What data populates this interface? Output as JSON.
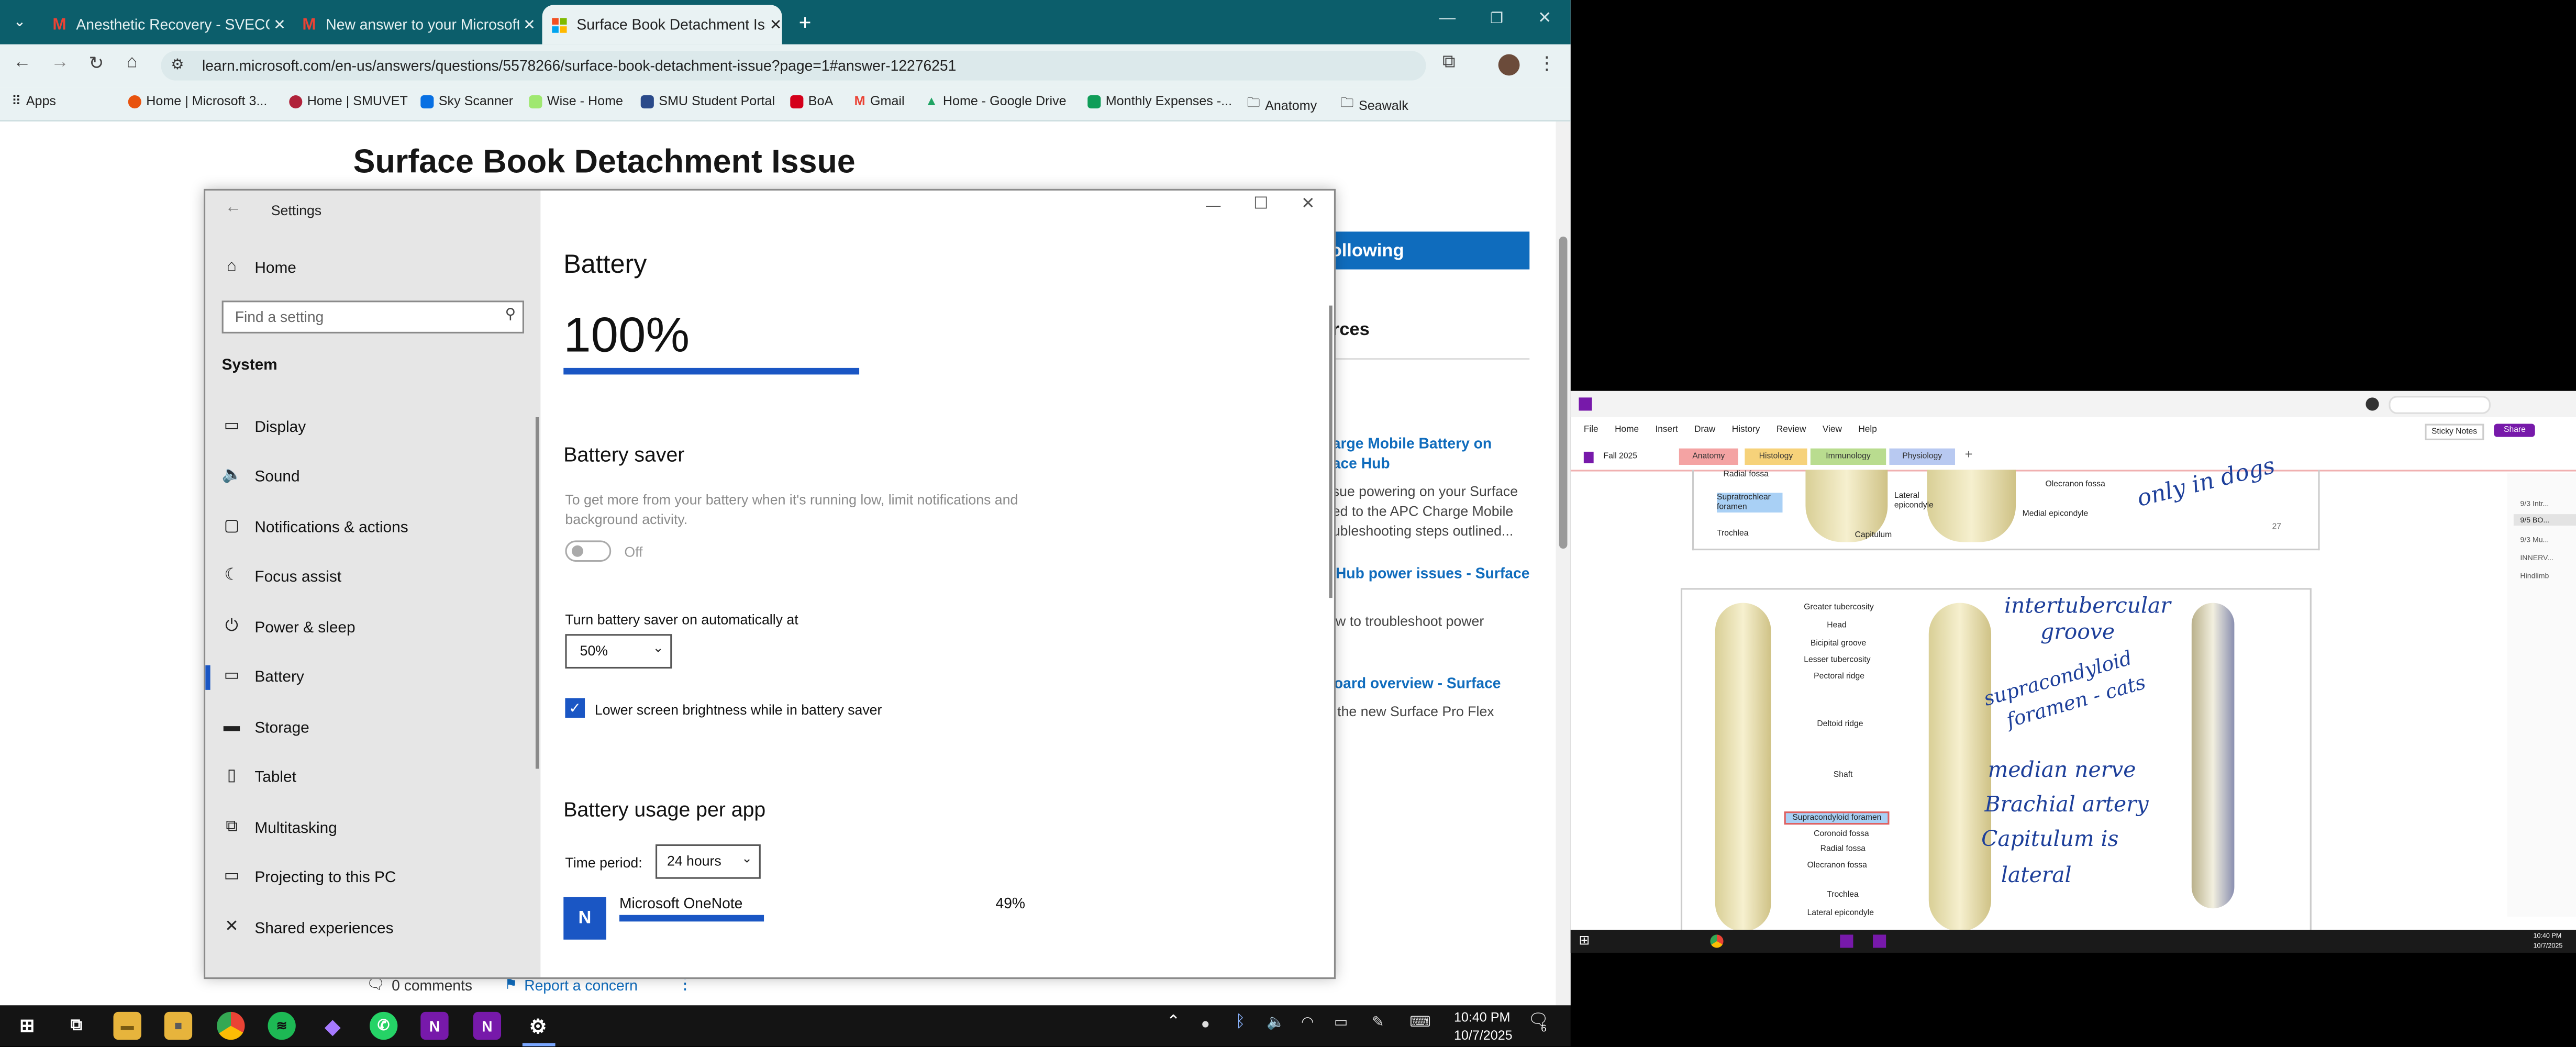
{
  "browser": {
    "tabs": [
      {
        "title": "Anesthetic Recovery - SVECCs",
        "favicon": "gmail"
      },
      {
        "title": "New answer to your Microsoft",
        "favicon": "gmail"
      },
      {
        "title": "Surface Book Detachment Issue",
        "favicon": "microsoft"
      }
    ],
    "url": "learn.microsoft.com/en-us/answers/questions/5578266/surface-book-detachment-issue?page=1#answer-12276251",
    "bookmarks": [
      "Apps",
      "Home | Microsoft 3...",
      "Home | SMUVET",
      "Sky Scanner",
      "Wise - Home",
      "SMU Student Portal",
      "BoA",
      "Gmail",
      "Home - Google Drive",
      "Monthly Expenses -...",
      "Anatomy",
      "Seawalk"
    ]
  },
  "qa_page": {
    "title": "Surface Book Detachment Issue",
    "follow_button": "ollowing",
    "resources_heading": "rces",
    "related": [
      {
        "link": "arge Mobile Battery on",
        "link2": "ace Hub",
        "desc": "sue powering on your Surface",
        "desc2": "ed to the APC Charge Mobile",
        "desc3": "ubleshooting steps outlined..."
      },
      {
        "link": "Hub power issues - Surface",
        "desc": "w to troubleshoot power"
      },
      {
        "link": "oard overview - Surface",
        "desc": "the new Surface Pro Flex"
      }
    ],
    "comments": "0 comments",
    "report": "Report a concern"
  },
  "settings": {
    "window_title": "Settings",
    "home": "Home",
    "search_placeholder": "Find a setting",
    "section": "System",
    "nav": [
      "Display",
      "Sound",
      "Notifications & actions",
      "Focus assist",
      "Power & sleep",
      "Battery",
      "Storage",
      "Tablet",
      "Multitasking",
      "Projecting to this PC",
      "Shared experiences"
    ],
    "nav_selected": "Battery",
    "heading": "Battery",
    "percent": "100%",
    "battery_level_fraction": 1.0,
    "saver_heading": "Battery saver",
    "saver_desc": "To get more from your battery when it's running low, limit notifications and background activity.",
    "saver_toggle": "Off",
    "auto_label": "Turn battery saver on automatically at",
    "auto_value": "50%",
    "brightness_label": "Lower screen brightness while in battery saver",
    "usage_heading": "Battery usage per app",
    "period_label": "Time period:",
    "period_value": "24 hours",
    "app_name": "Microsoft OneNote",
    "app_percent": "49%",
    "app_usage_fraction": 0.49
  },
  "taskbar": {
    "time": "10:40 PM",
    "date": "10/7/2025",
    "notifications": "6"
  },
  "onenote": {
    "menu": [
      "File",
      "Home",
      "Insert",
      "Draw",
      "History",
      "Review",
      "View",
      "Help"
    ],
    "sticky_notes": "Sticky Notes",
    "share": "Share",
    "notebook": "Fall 2025",
    "sections": [
      "Anatomy",
      "Histology",
      "Immunology",
      "Physiology"
    ],
    "pages": [
      "9/3 Intr...",
      "9/5 BO...",
      "9/3 Mu...",
      "INNERV...",
      "Hindlimb"
    ],
    "labels_top": [
      "Radial fossa",
      "Supratrochlear foramen",
      "Trochlea",
      "Lateral epicondyle",
      "Capitulum",
      "Olecranon fossa",
      "Medial epicondyle"
    ],
    "labels_main": [
      "Greater tubercosity",
      "Head",
      "Bicipital groove",
      "Lesser tubercosity",
      "Pectoral ridge",
      "Deltoid ridge",
      "Shaft",
      "Supracondyloid foramen",
      "Coronoid fossa",
      "Radial fossa",
      "Olecranon fossa",
      "Trochlea",
      "Lateral epicondyle"
    ],
    "handwriting": [
      "only in dogs",
      "intertubercular",
      "groove",
      "supracondyloid",
      "foramen - cats",
      "median nerve",
      "Brachial artery",
      "Capitulum is",
      "lateral"
    ],
    "page_number": "27",
    "time": "10:40 PM",
    "date": "10/7/2025"
  },
  "colors": {
    "accent": "#1a56c4",
    "chrome": "#0c5e6b",
    "onenote": "#7719aa"
  }
}
